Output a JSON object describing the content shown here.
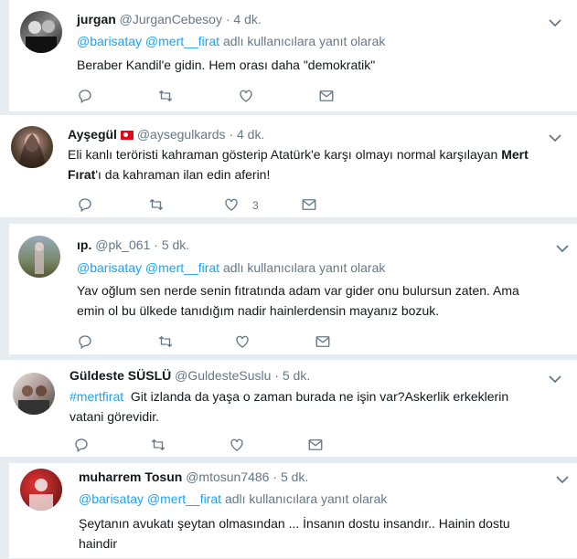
{
  "reply_prefix": "adlı kullanıcılara yanıt olarak",
  "tweets": [
    {
      "name": "jurgan",
      "handle": "@JurganCebesoy",
      "time": "4 dk.",
      "mentions": [
        "@barisatay",
        "@mert__firat"
      ],
      "text": "Beraber Kandil'e gidin. Hem orası daha \"demokratik\""
    },
    {
      "name": "Ayşegül",
      "handle": "@aysegulkards",
      "time": "4 dk.",
      "text_part1": "Eli kanlı teröristi kahraman gösterip Atatürk'e karşı olmayı normal karşılayan",
      "text_bold": "Mert",
      "text_part2_bold": "Fırat",
      "text_part3": "'ı da kahraman ilan edin aferin!",
      "like_count": "3"
    },
    {
      "name": "ıp.",
      "handle": "@pk_061",
      "time": "5 dk.",
      "mentions": [
        "@barisatay",
        "@mert__firat"
      ],
      "text_line1": "Yav oğlum sen nerde senin fıtratında adam var gider onu bulursun zaten. Ama",
      "text_line2": "emin ol bu ülkede tanıdığım nadir hainlerdensin mayanız bozuk."
    },
    {
      "name": "Güldeste SÜSLÜ",
      "handle": "@GuldesteSuslu",
      "time": "5 dk.",
      "hashtag": "#mertfirat",
      "text_line1": "Git izlanda da yaşa o zaman burada ne işin var?Askerlik erkeklerin",
      "text_line2": "vatani görevidir."
    },
    {
      "name": "muharrem Tosun",
      "handle": "@mtosun7486",
      "time": "5 dk.",
      "mentions": [
        "@barisatay",
        "@mert__firat"
      ],
      "text_line1": "Şeytanın avukatı şeytan olmasından ... İnsanın dostu insandır.. Hainin dostu",
      "text_line2": "haindir"
    }
  ],
  "dot": "·",
  "icons": [
    "reply-icon",
    "retweet-icon",
    "like-icon",
    "dm-icon",
    "caret-down-icon"
  ],
  "colors": {
    "link": "#1da1f2",
    "muted": "#657786",
    "text": "#14171a",
    "bg": "#e6ecf0"
  }
}
